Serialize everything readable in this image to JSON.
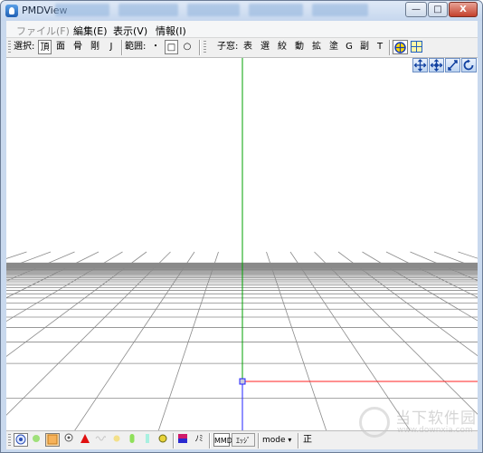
{
  "window": {
    "title": "PMDView",
    "buttons": {
      "minimize": "—",
      "maximize": "□",
      "close": "X"
    }
  },
  "menu": [
    {
      "label": "ファイル(F)",
      "enabled": false
    },
    {
      "label": "編集(E)",
      "enabled": true
    },
    {
      "label": "表示(V)",
      "enabled": true
    },
    {
      "label": "情報(I)",
      "enabled": true
    }
  ],
  "toolbar": {
    "select_label": "選択:",
    "select_items": [
      "頂",
      "面",
      "骨",
      "剛",
      "J"
    ],
    "range_label": "範囲:",
    "range_items": [
      "・",
      "□",
      "○"
    ],
    "child_label": "子窓:",
    "child_items": [
      "表",
      "選",
      "絞",
      "動",
      "拡",
      "塗",
      "G",
      "副",
      "T"
    ]
  },
  "viewport": {
    "axis_colors": {
      "y": "#00a000",
      "x": "#ff2020",
      "z": "#2020ff",
      "grid": "#8a8a8a"
    },
    "nav_icons": [
      "move-icon",
      "rotate-icon",
      "zoom-icon",
      "reset-view-icon"
    ]
  },
  "statusbar": {
    "mmd_label": "MMD",
    "edge_label": "ｴｯｼﾞ",
    "mode_label": "mode",
    "mode_arrow": "▾",
    "nomi_label": "ﾉﾐ",
    "sei_label": "正"
  },
  "watermark": {
    "title": "当下软件园",
    "url": "www.downxia.com"
  }
}
